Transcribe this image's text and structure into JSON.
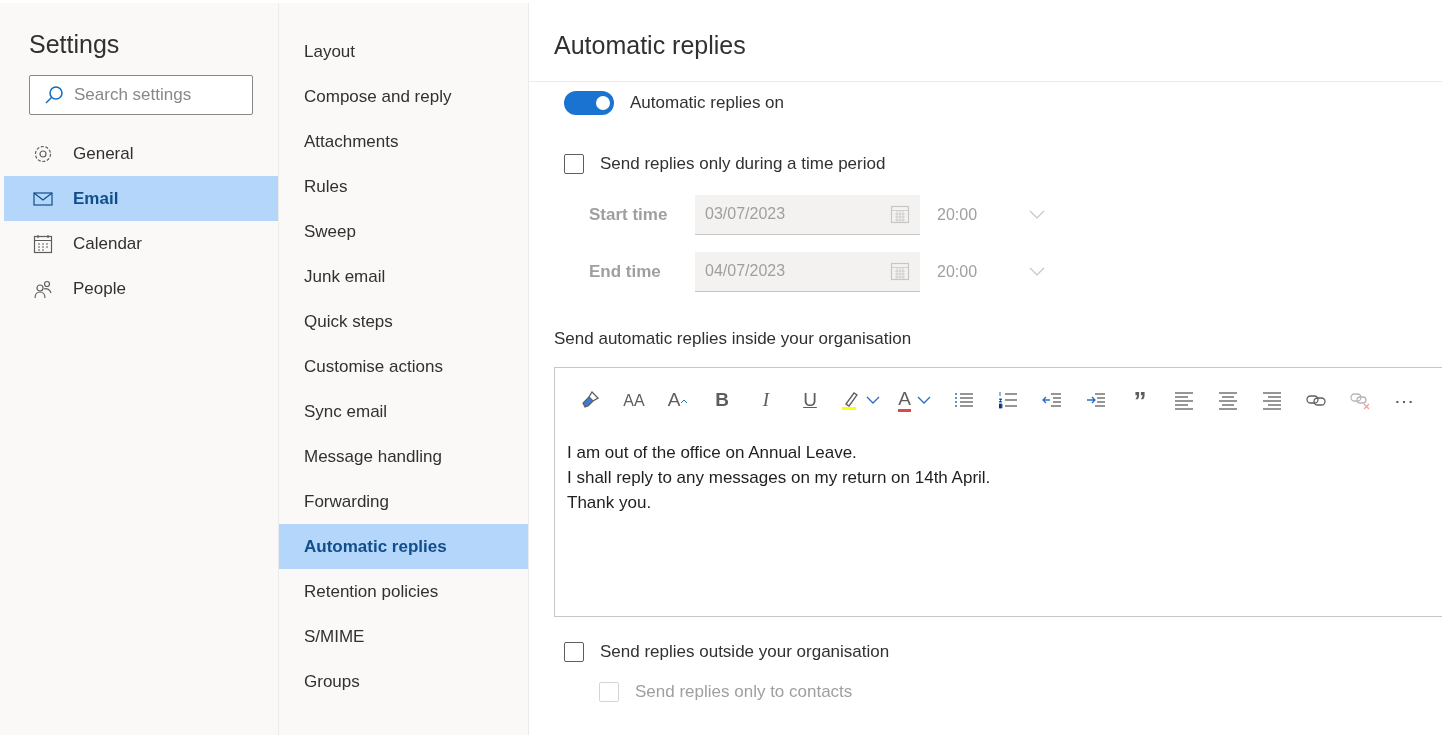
{
  "settings_sidebar": {
    "title": "Settings",
    "search": {
      "placeholder": "Search settings"
    },
    "items": [
      {
        "kind": "general",
        "label": "General",
        "selected": false
      },
      {
        "kind": "email",
        "label": "Email",
        "selected": true
      },
      {
        "kind": "calendar",
        "label": "Calendar",
        "selected": false
      },
      {
        "kind": "people",
        "label": "People",
        "selected": false
      }
    ]
  },
  "email_menu": [
    {
      "label": "Layout",
      "selected": false
    },
    {
      "label": "Compose and reply",
      "selected": false
    },
    {
      "label": "Attachments",
      "selected": false
    },
    {
      "label": "Rules",
      "selected": false
    },
    {
      "label": "Sweep",
      "selected": false
    },
    {
      "label": "Junk email",
      "selected": false
    },
    {
      "label": "Quick steps",
      "selected": false
    },
    {
      "label": "Customise actions",
      "selected": false
    },
    {
      "label": "Sync email",
      "selected": false
    },
    {
      "label": "Message handling",
      "selected": false
    },
    {
      "label": "Forwarding",
      "selected": false
    },
    {
      "label": "Automatic replies",
      "selected": true
    },
    {
      "label": "Retention policies",
      "selected": false
    },
    {
      "label": "S/MIME",
      "selected": false
    },
    {
      "label": "Groups",
      "selected": false
    }
  ],
  "panel": {
    "title": "Automatic replies",
    "toggle": {
      "label": "Automatic replies on",
      "on": true
    },
    "time_period": {
      "label": "Send replies only during a time period",
      "checked": false
    },
    "times": [
      {
        "label": "Start time",
        "date": "03/07/2023",
        "time": "20:00",
        "disabled": true
      },
      {
        "label": "End time",
        "date": "04/07/2023",
        "time": "20:00",
        "disabled": true
      }
    ],
    "inside_label": "Send automatic replies inside your organisation",
    "toolbar": [
      {
        "kind": "format-painter",
        "disabled": false
      },
      {
        "kind": "font-size",
        "label": "AA",
        "disabled": false
      },
      {
        "kind": "grow-font",
        "label": "A",
        "disabled": false
      },
      {
        "kind": "bold",
        "label": "B",
        "disabled": false
      },
      {
        "kind": "italic",
        "label": "I",
        "disabled": false
      },
      {
        "kind": "underline",
        "label": "U",
        "disabled": false
      },
      {
        "kind": "highlight",
        "color": "#ffff00",
        "disabled": false
      },
      {
        "kind": "font-color",
        "label": "A",
        "color": "#e04848",
        "disabled": false
      },
      {
        "kind": "bullets",
        "disabled": false
      },
      {
        "kind": "numbering",
        "disabled": false
      },
      {
        "kind": "outdent",
        "disabled": false
      },
      {
        "kind": "indent",
        "disabled": false
      },
      {
        "kind": "quote",
        "label": "”",
        "disabled": false
      },
      {
        "kind": "align-left",
        "disabled": false
      },
      {
        "kind": "align-center",
        "disabled": false
      },
      {
        "kind": "align-right",
        "disabled": false
      },
      {
        "kind": "link",
        "disabled": false
      },
      {
        "kind": "unlink",
        "disabled": true
      },
      {
        "kind": "more",
        "label": "⋯",
        "disabled": false
      }
    ],
    "message": [
      "I am out of the office on Annual Leave.",
      "I shall reply to any messages on my return on 14th April.",
      "Thank you."
    ],
    "outside": {
      "label": "Send replies outside your organisation",
      "checked": false,
      "disabled": false
    },
    "contacts_only": {
      "label": "Send replies only to contacts",
      "checked": false,
      "disabled": true
    }
  }
}
